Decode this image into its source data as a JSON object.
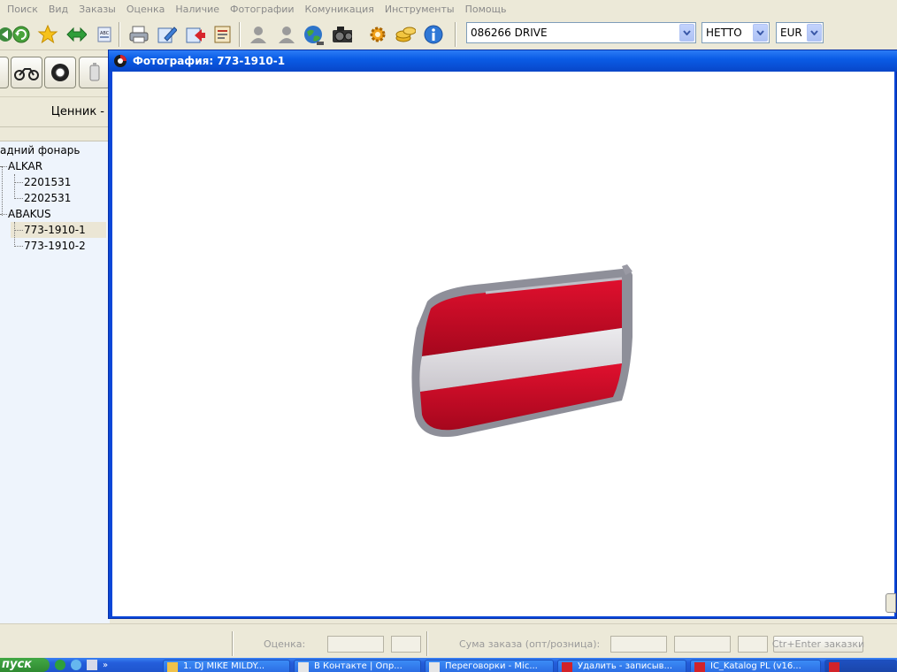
{
  "menu": [
    "Поиск",
    "Вид",
    "Заказы",
    "Оценка",
    "Наличие",
    "Фотографии",
    "Комуникация",
    "Инструменты",
    "Помощь"
  ],
  "toolbar": {
    "catalog_value": "086266  DRIVE",
    "price_type_value": "НЕТТО",
    "currency_value": "EUR"
  },
  "left_panel": {
    "price_label": "Ценник -"
  },
  "tree": {
    "root": "адний фонарь",
    "brand1": "ALKAR",
    "brand1_items": [
      "2201531",
      "2202531"
    ],
    "brand2": "ABAKUS",
    "brand2_items": [
      "773-1910-1",
      "773-1910-2"
    ]
  },
  "photo_window": {
    "title": "Фотография: 773-1910-1"
  },
  "statusbar": {
    "estimate_label": "Оценка:",
    "order_sum_label": "Сума заказа (опт/розница):",
    "order_button": "Ctr+Enter заказки"
  },
  "taskbar": {
    "start_label": "пуск",
    "tasks": [
      "1. DJ MIKE MILDY...",
      "В Контакте | Опр...",
      "Переговорки - Mic...",
      "Удалить - записыв...",
      "IC_Katalog PL (v16..."
    ]
  },
  "colors": {
    "title_bar": "#0a5ce6",
    "taskbar": "#245edb",
    "tree_background": "#eef4fc",
    "selection": "#ebe6d5"
  }
}
